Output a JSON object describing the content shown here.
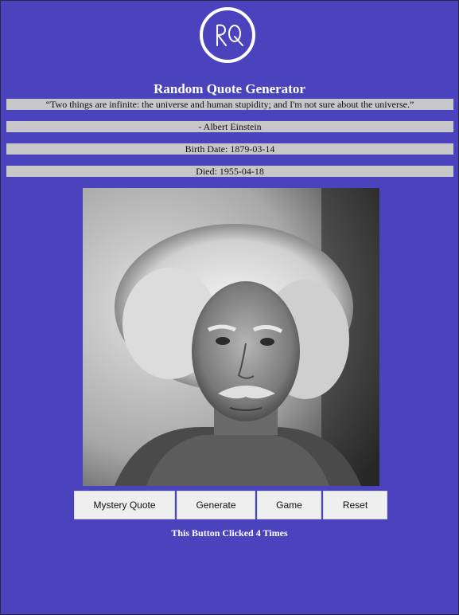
{
  "logo": {
    "text": "RQ"
  },
  "title": "Random Quote Generator",
  "quote": {
    "text": "“Two things are infinite: the universe and human stupidity; and I'm not sure about the universe.”",
    "author": "- Albert Einstein",
    "birth": "Birth Date: 1879-03-14",
    "died": "Died: 1955-04-18"
  },
  "buttons": {
    "mystery": "Mystery Quote",
    "generate": "Generate",
    "game": "Game",
    "reset": "Reset"
  },
  "counter_text": "This Button Clicked 4 Times",
  "colors": {
    "background": "#4a43bd",
    "bar": "#c7c7c9",
    "button": "#efefef"
  }
}
